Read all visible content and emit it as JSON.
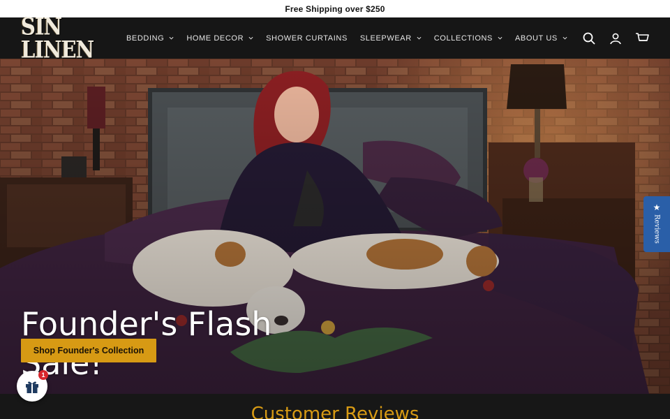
{
  "announcement": {
    "text": "Free Shipping over $250"
  },
  "header": {
    "logo_text": "SIN LINEN",
    "nav": [
      {
        "label": "BEDDING",
        "has_dropdown": true
      },
      {
        "label": "HOME DECOR",
        "has_dropdown": true
      },
      {
        "label": "SHOWER CURTAINS",
        "has_dropdown": false
      },
      {
        "label": "SLEEPWEAR",
        "has_dropdown": true
      },
      {
        "label": "COLLECTIONS",
        "has_dropdown": true
      },
      {
        "label": "ABOUT US",
        "has_dropdown": true
      }
    ],
    "icons": [
      "search-icon",
      "account-icon",
      "cart-icon"
    ]
  },
  "hero": {
    "title": "Founder's Flash Sale!",
    "button_label": "Shop Founder's Collection",
    "image_description_icon": "hero-photo"
  },
  "reviews_tab": {
    "label": "Reviews",
    "icon": "star-icon"
  },
  "gift_widget": {
    "badge_count": "1",
    "icon": "gift-icon"
  },
  "next_section": {
    "title": "Customer Reviews"
  },
  "colors": {
    "accent": "#d79a14",
    "header_bg": "#161616",
    "reviews_tab": "#2a5fa8",
    "badge": "#d7262d"
  }
}
